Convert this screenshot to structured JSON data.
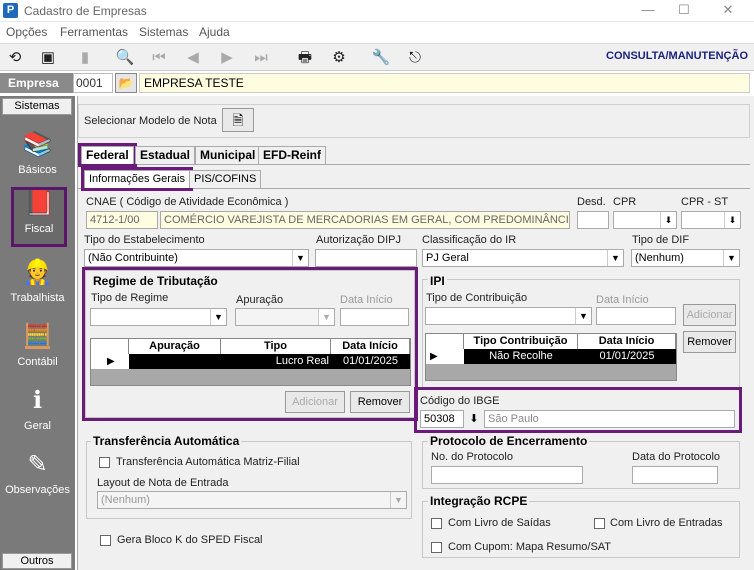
{
  "window": {
    "title": "Cadastro de Empresas",
    "app_icon": "P"
  },
  "menu": [
    "Opções",
    "Ferramentas",
    "Sistemas",
    "Ajuda"
  ],
  "toolbar": {
    "mode": "CONSULTA/MANUTENÇÃO"
  },
  "empresa": {
    "label": "Empresa",
    "code": "0001",
    "name": "EMPRESA TESTE"
  },
  "sidebar": {
    "header": "Sistemas",
    "footer": "Outros",
    "items": [
      "Básicos",
      "Fiscal",
      "Trabalhista",
      "Contábil",
      "Geral",
      "Observações"
    ]
  },
  "model": {
    "label": "Selecionar Modelo de Nota"
  },
  "tabs": [
    "Federal",
    "Estadual",
    "Municipal",
    "EFD-Reinf"
  ],
  "subtabs": [
    "Informações Gerais",
    "PIS/COFINS"
  ],
  "cnae": {
    "label": "CNAE ( Código de  Atividade Econômica )",
    "code": "4712-1/00",
    "desc": "COMÉRCIO VAREJISTA DE MERCADORIAS EM GERAL, COM PREDOMINÂNCIA DE"
  },
  "desd": {
    "label": "Desd."
  },
  "cpr": {
    "label": "CPR"
  },
  "cpr_st": {
    "label": "CPR - ST"
  },
  "estab": {
    "label": "Tipo do Estabelecimento",
    "value": "(Não Contribuinte)"
  },
  "dipj": {
    "label": "Autorização DIPJ"
  },
  "class_ir": {
    "label": "Classificação do IR",
    "value": "PJ Geral"
  },
  "dif": {
    "label": "Tipo de DIF",
    "value": "(Nenhum)"
  },
  "regime": {
    "title": "Regime de Tributação",
    "tipo_label": "Tipo de Regime",
    "apur_label": "Apuração",
    "data_label": "Data Início",
    "cols": [
      "Apuração",
      "Tipo",
      "Data Início"
    ],
    "row": [
      "",
      "Lucro Real",
      "01/01/2025"
    ],
    "add": "Adicionar",
    "remove": "Remover"
  },
  "ipi": {
    "title": "IPI",
    "tipo_label": "Tipo de Contribuição",
    "data_label": "Data Início",
    "add": "Adicionar",
    "remove": "Remover",
    "cols": [
      "Tipo Contribuição",
      "Data Início"
    ],
    "row": [
      "Não Recolhe",
      "01/01/2025"
    ]
  },
  "ibge": {
    "label": "Código do IBGE",
    "code": "50308",
    "city": "São Paulo"
  },
  "transf": {
    "title": "Transferência Automática",
    "check": "Transferência Automática Matriz-Filial",
    "layout_label": "Layout de Nota de Entrada",
    "layout_value": "(Nenhum)"
  },
  "bloco_k": {
    "label": "Gera Bloco K do SPED Fiscal"
  },
  "protocolo": {
    "title": "Protocolo de Encerramento",
    "num_label": "No. do Protocolo",
    "data_label": "Data do Protocolo"
  },
  "rcpe": {
    "title": "Integração RCPE",
    "saidas": "Com Livro de Saídas",
    "entradas": "Com Livro de Entradas",
    "cupom": "Com Cupom: Mapa Resumo/SAT"
  }
}
